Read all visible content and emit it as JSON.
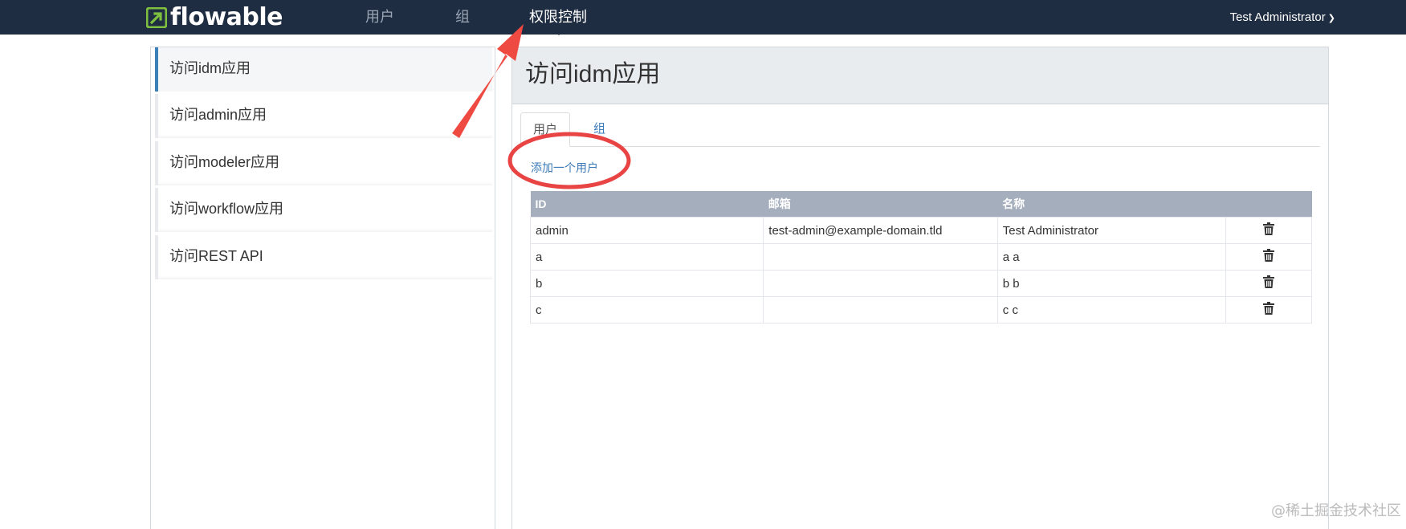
{
  "brand": {
    "name": "flowable",
    "accent_color": "#7fbf3f",
    "navbar_color": "#1f2d42"
  },
  "nav": {
    "items": [
      {
        "label": "用户"
      },
      {
        "label": "组"
      },
      {
        "label": "权限控制"
      }
    ],
    "active_index": 2,
    "user_name": "Test Administrator",
    "user_chevron": "chevron-down-icon"
  },
  "sidebar": {
    "items": [
      {
        "label": "访问idm应用"
      },
      {
        "label": "访问admin应用"
      },
      {
        "label": "访问modeler应用"
      },
      {
        "label": "访问workflow应用"
      },
      {
        "label": "访问REST API"
      }
    ],
    "active_index": 0
  },
  "main": {
    "title": "访问idm应用",
    "tabs": [
      {
        "label": "用户"
      },
      {
        "label": "组"
      }
    ],
    "add_user_link": "添加一个用户",
    "table": {
      "headers": [
        "ID",
        "邮箱",
        "名称",
        ""
      ],
      "rows": [
        {
          "id": "admin",
          "email": "test-admin@example-domain.tld",
          "name": "Test Administrator"
        },
        {
          "id": "a",
          "email": "",
          "name": "a a"
        },
        {
          "id": "b",
          "email": "",
          "name": "b b"
        },
        {
          "id": "c",
          "email": "",
          "name": "c c"
        }
      ],
      "row_action_icon": "trash-icon"
    }
  },
  "annotations": {
    "arrow_color": "#ee4a42",
    "circle_color": "#e84444"
  },
  "watermark": "@稀土掘金技术社区"
}
